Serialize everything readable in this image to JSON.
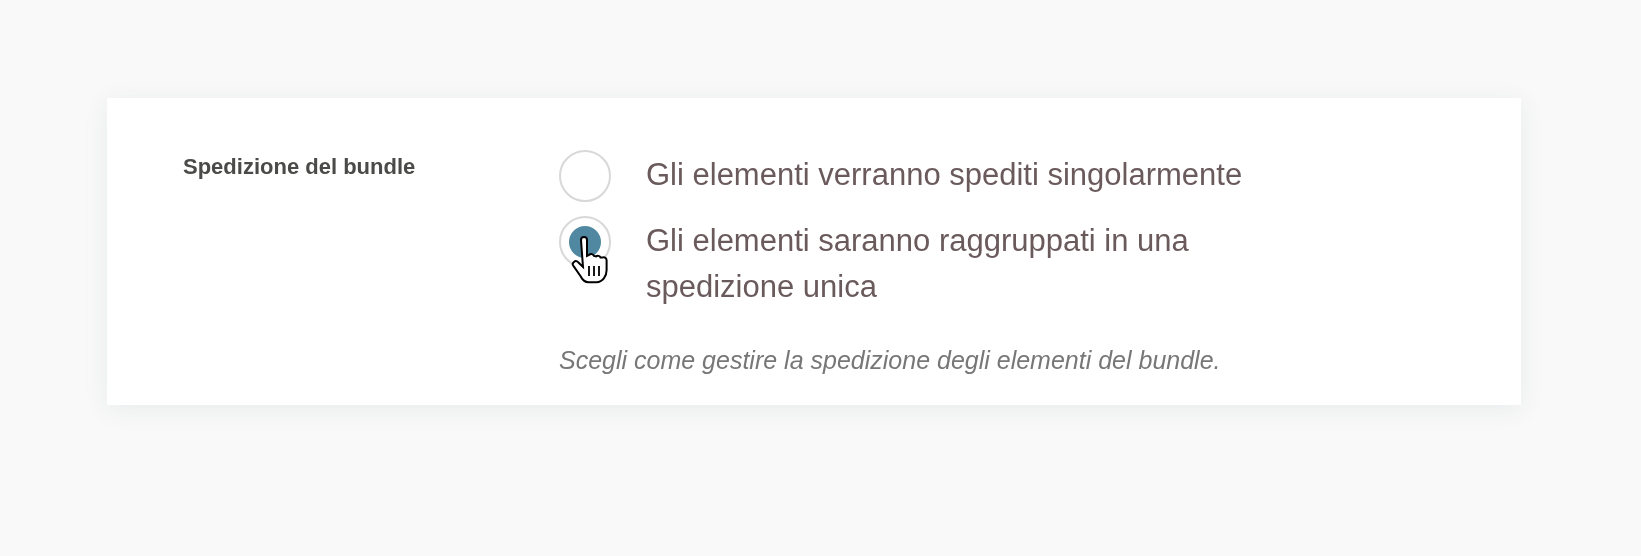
{
  "setting": {
    "label": "Spedizione del bundle",
    "options": [
      {
        "label": "Gli elementi verranno spediti singolarmente",
        "selected": false
      },
      {
        "label": "Gli elementi saranno raggruppati in una spedizione unica",
        "selected": true
      }
    ],
    "hint": "Scegli come gestire la spedizione degli elementi del bundle."
  }
}
